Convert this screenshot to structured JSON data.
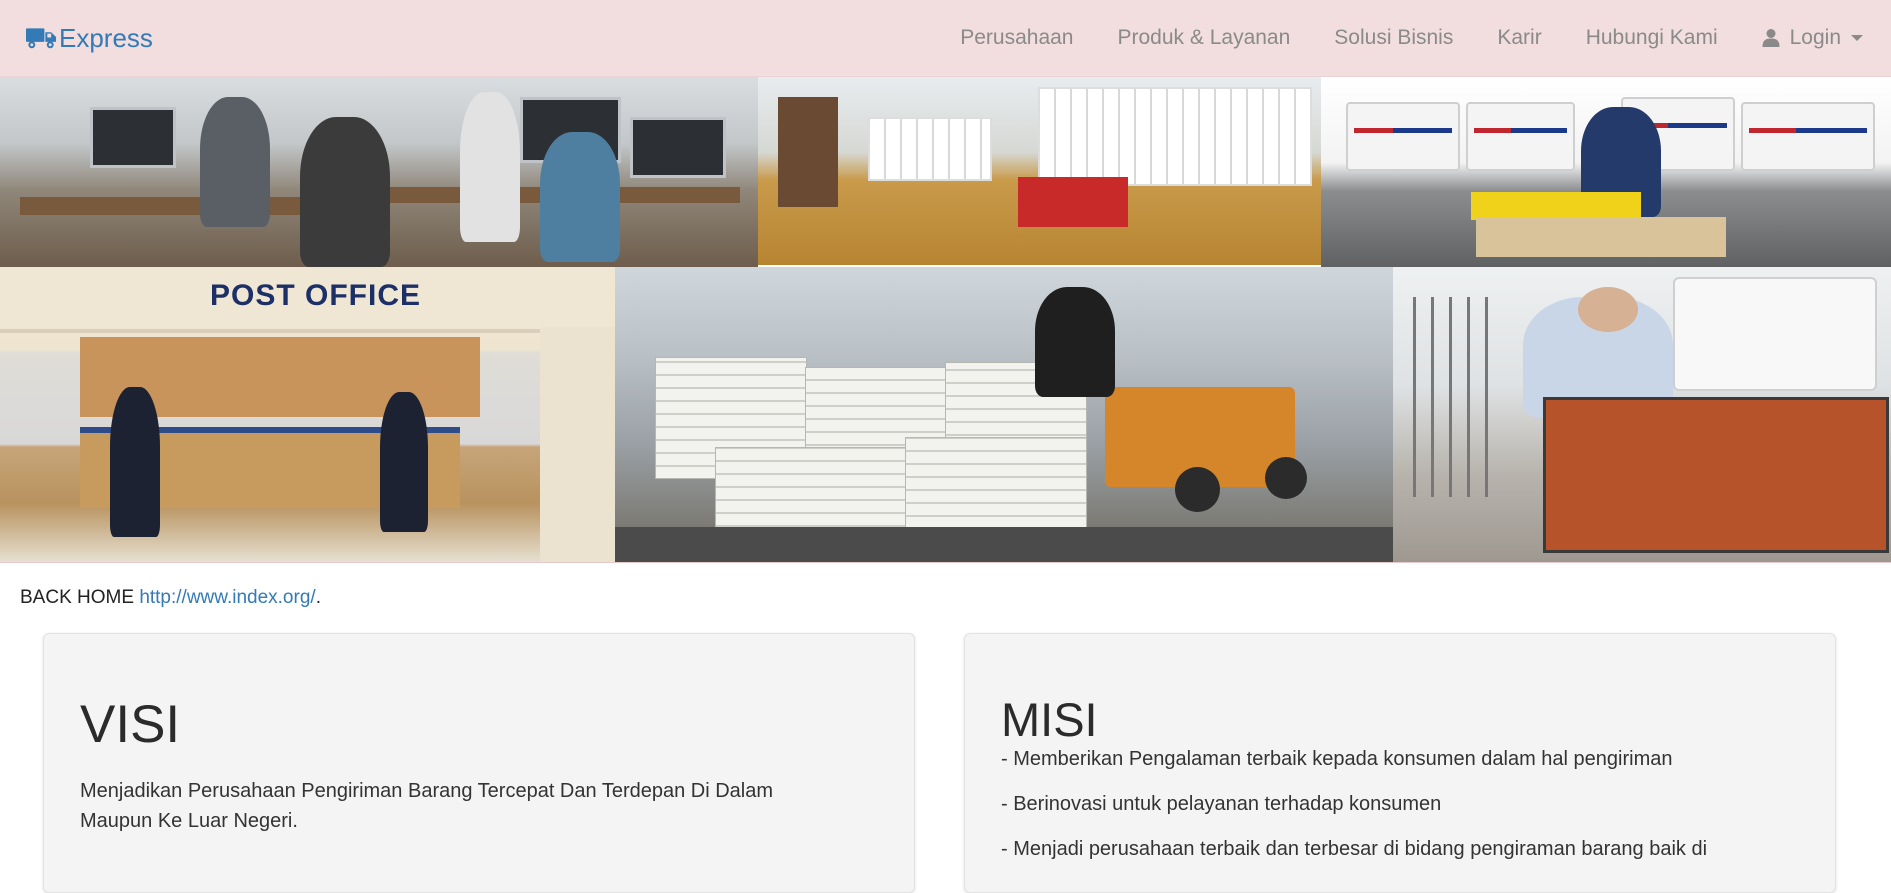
{
  "navbar": {
    "brand": "Express",
    "links": [
      "Perusahaan",
      "Produk & Layanan",
      "Solusi Bisnis",
      "Karir",
      "Hubungi Kami"
    ],
    "login": "Login"
  },
  "hero": {
    "post_office_sign": "POST OFFICE"
  },
  "back_home": {
    "prefix": "BACK HOME ",
    "link": "http://www.index.org/",
    "suffix": "."
  },
  "visi": {
    "title": "VISI",
    "text": "Menjadikan Perusahaan Pengiriman Barang Tercepat Dan Terdepan Di Dalam Maupun Ke Luar Negeri."
  },
  "misi": {
    "title": "MISI",
    "items": [
      "- Memberikan Pengalaman terbaik kepada konsumen dalam hal pengiriman",
      "- Berinovasi untuk pelayanan terhadap konsumen",
      "- Menjadi perusahaan terbaik dan terbesar di bidang pengiraman barang baik di"
    ]
  },
  "colors": {
    "navbar_bg": "#f2dede",
    "brand": "#337ab7",
    "nav_link": "#8a8a8a",
    "link": "#337ab7",
    "panel_bg": "#f4f4f4"
  },
  "icons": {
    "brand": "truck-icon",
    "login": "user-icon",
    "dropdown": "caret-down-icon"
  }
}
